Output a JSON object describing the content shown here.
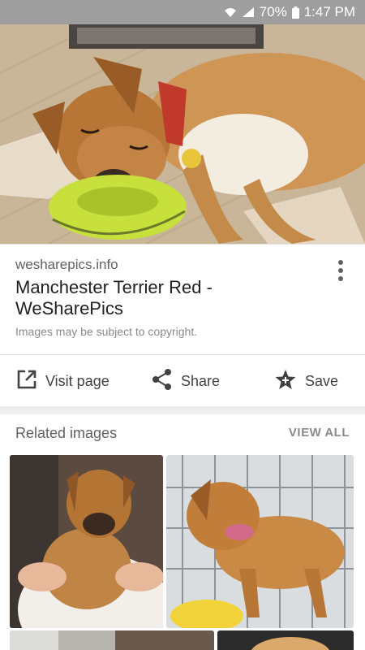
{
  "status_bar": {
    "battery": "70%",
    "time": "1:47 PM",
    "icons": [
      "wifi-icon",
      "signal-icon",
      "battery-icon"
    ]
  },
  "hero_image": {
    "icon": "dog-photo"
  },
  "result": {
    "source": "wesharepics.info",
    "title": "Manchester Terrier Red - WeSharePics",
    "copyright": "Images may be subject to copyright."
  },
  "actions": {
    "visit": "Visit page",
    "share": "Share",
    "save": "Save"
  },
  "related": {
    "title": "Related images",
    "view_all": "VIEW ALL"
  },
  "colors": {
    "status_bar": "#9e9e9e",
    "text_primary": "#212121",
    "text_secondary": "#616161",
    "divider": "#e0e0e0"
  }
}
